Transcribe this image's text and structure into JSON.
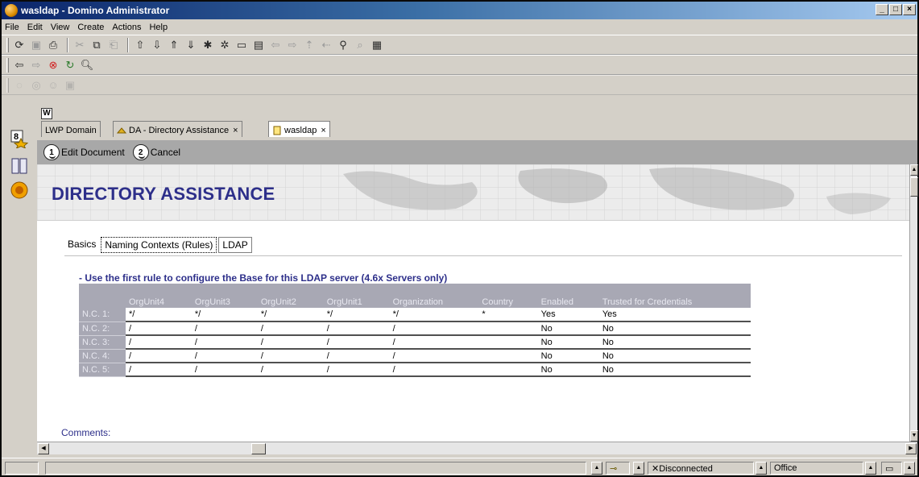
{
  "window": {
    "title": "wasldap - Domino Administrator",
    "controls": [
      "_",
      "□",
      "×"
    ]
  },
  "menu": [
    "File",
    "Edit",
    "View",
    "Create",
    "Actions",
    "Help"
  ],
  "tabs": [
    {
      "label": "LWP Domain",
      "close": ""
    },
    {
      "label": "DA - Directory Assistance",
      "close": "×"
    },
    {
      "label": "wasldap",
      "close": "×"
    }
  ],
  "tab_badge": "W",
  "rail_badge": "8",
  "actions": {
    "edit": {
      "num": "1",
      "label": "Edit Document"
    },
    "cancel": {
      "num": "2",
      "label": "Cancel"
    }
  },
  "banner_title": "DIRECTORY ASSISTANCE",
  "subtabs": [
    "Basics",
    "Naming Contexts (Rules)",
    "LDAP"
  ],
  "rule_heading": "- Use the first rule to configure the Base for this LDAP server (4.6x Servers only)",
  "table": {
    "columns": [
      "",
      "OrgUnit4",
      "OrgUnit3",
      "OrgUnit2",
      "OrgUnit1",
      "Organization",
      "Country",
      "Enabled",
      "Trusted for Credentials"
    ],
    "rows": [
      {
        "label": "N.C. 1:",
        "cells": [
          "*/",
          "*/",
          "*/",
          "*/",
          "*/",
          "*",
          "Yes",
          "Yes"
        ]
      },
      {
        "label": "N.C. 2:",
        "cells": [
          "/",
          "/",
          "/",
          "/",
          "/",
          "",
          "No",
          "No"
        ]
      },
      {
        "label": "N.C. 3:",
        "cells": [
          "/",
          "/",
          "/",
          "/",
          "/",
          "",
          "No",
          "No"
        ]
      },
      {
        "label": "N.C. 4:",
        "cells": [
          "/",
          "/",
          "/",
          "/",
          "/",
          "",
          "No",
          "No"
        ]
      },
      {
        "label": "N.C. 5:",
        "cells": [
          "/",
          "/",
          "/",
          "/",
          "/",
          "",
          "No",
          "No"
        ]
      }
    ]
  },
  "comments_label": "Comments:",
  "status": {
    "connection": "Disconnected",
    "location": "Office"
  }
}
